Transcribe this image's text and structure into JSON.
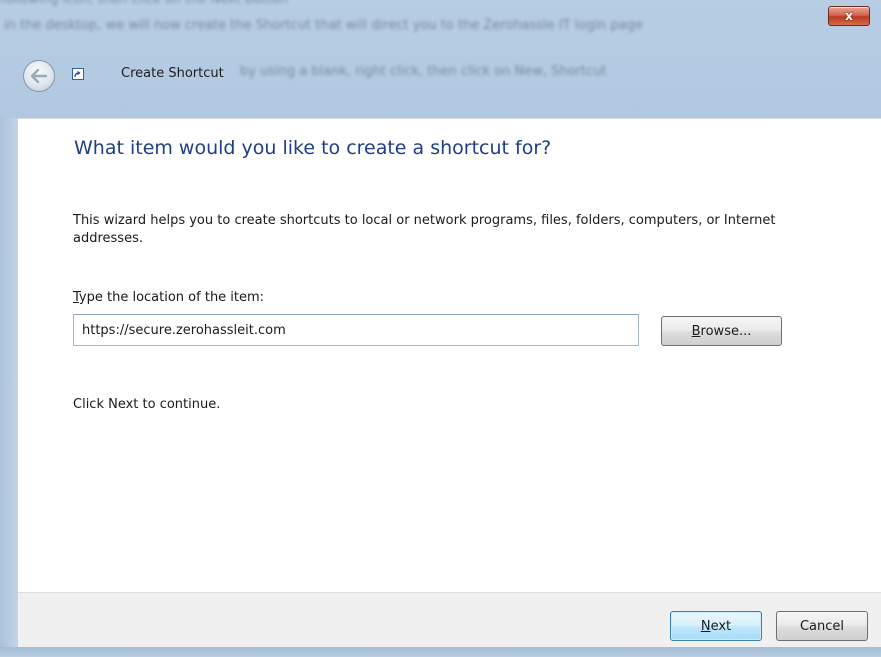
{
  "window": {
    "title": "Create Shortcut",
    "close_label": "x",
    "background_text_line1": "in the desktop, we will now create the Shortcut that will direct you to the Zerohassle IT login page",
    "background_text_line2": "by using a blank, right click, then click on New, Shortcut",
    "background_text_top": "following icon, then click on the Next button"
  },
  "page": {
    "heading": "What item would you like to create a shortcut for?",
    "description": "This wizard helps you to create shortcuts to local or network programs, files, folders, computers, or Internet addresses.",
    "field_label_accel": "T",
    "field_label_rest": "ype the location of the item:",
    "location_value": "https://secure.zerohassleit.com",
    "browse_accel": "B",
    "browse_rest": "rowse...",
    "continue_text": "Click Next to continue."
  },
  "footer": {
    "next_accel": "N",
    "next_rest": "ext",
    "cancel_label": "Cancel"
  },
  "colors": {
    "heading": "#1f3e87",
    "frame": "#b7cde4",
    "close": "#c8462c",
    "default_button": "#bee6fd"
  },
  "icons": {
    "back": "back-arrow-icon",
    "shortcut": "shortcut-arrow-icon",
    "close": "close-icon"
  }
}
